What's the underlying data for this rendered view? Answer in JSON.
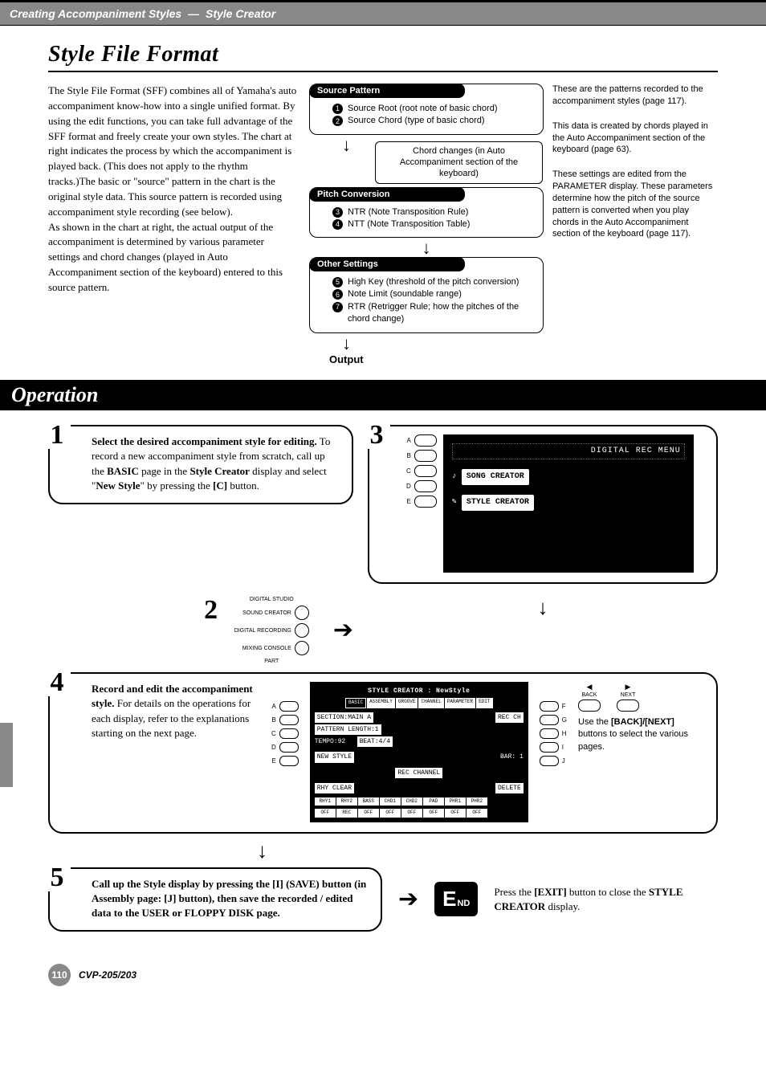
{
  "header": {
    "breadcrumb_left": "Creating Accompaniment Styles",
    "breadcrumb_right": "Style Creator"
  },
  "sff": {
    "title": "Style File Format",
    "para1": "The Style File Format (SFF) combines all of Yamaha's auto accompaniment know-how into a single unified format. By using the edit functions, you can take full advantage of the SFF format and freely create your own styles. The chart at right indicates the process by which the accompaniment is played back. (This does not apply to the rhythm tracks.)The basic or \"source\" pattern in the chart is the original style data. This source pattern is recorded using accompaniment style recording (see below).",
    "para2": "As shown in the chart at right, the actual output of the accompaniment is determined by various parameter settings and chord changes (played in Auto Accompaniment section of the keyboard) entered to this source pattern.",
    "box1_header": "Source Pattern",
    "box1_items": [
      "Source Root (root note of basic chord)",
      "Source Chord (type of basic chord)"
    ],
    "chord_note": "Chord changes (in Auto Accompaniment section of the keyboard)",
    "box2_header": "Pitch Conversion",
    "box2_items": [
      "NTR (Note Transposition Rule)",
      "NTT (Note Transposition Table)"
    ],
    "box3_header": "Other Settings",
    "box3_items": [
      "High Key (threshold of the pitch conversion)",
      "Note Limit (soundable range)",
      "RTR (Retrigger Rule; how the pitches of the chord change)"
    ],
    "output_label": "Output",
    "side1": "These are the patterns recorded to the accompaniment styles (page 117).",
    "side2": "This data is created by chords played in the Auto Accompaniment section of the keyboard (page 63).",
    "side3": "These settings are edited from the PARAMETER display. These parameters determine how the pitch of the source pattern is converted when you play chords in the Auto Accompaniment section of the keyboard (page 117)."
  },
  "operation": {
    "title": "Operation",
    "step1_num": "1",
    "step1_bold": "Select the desired accompaniment style for editing.",
    "step1_rest": " To record a new accompaniment style from scratch, call up the ",
    "step1_basic": "BASIC",
    "step1_mid": " page in the ",
    "step1_sc": "Style Creator",
    "step1_disp": " display and select \"",
    "step1_ns": "New Style",
    "step1_end": "\" by pressing the ",
    "step1_c": "[C]",
    "step1_btn": " button.",
    "step2_num": "2",
    "panel_header": "DIGITAL STUDIO",
    "panel_items": [
      "SOUND CREATOR",
      "DIGITAL RECORDING",
      "MIXING CONSOLE"
    ],
    "panel_footer": "PART",
    "step3_num": "3",
    "screen1_title": "DIGITAL REC MENU",
    "screen1_items": [
      "SONG CREATOR",
      "STYLE CREATOR"
    ],
    "screen1_side_labels": [
      "A",
      "B",
      "C",
      "D",
      "E"
    ],
    "step4_num": "4",
    "step4_bold": "Record and edit the accompaniment style.",
    "step4_rest": " For details on the operations for each display, refer to the explanations starting on the next page.",
    "back_label": "BACK",
    "next_label": "NEXT",
    "back_next_tip_prefix": "Use the ",
    "back_next_tip_bold": "[BACK]/[NEXT]",
    "back_next_tip_suffix": " buttons to select the various pages.",
    "screen2_title": "STYLE CREATOR : NewStyle",
    "screen2_tabs": [
      "BASIC",
      "ASSEMBLY",
      "GROOVE",
      "CHANNEL",
      "PARAMETER",
      "EDIT"
    ],
    "screen2_section": "SECTION:MAIN A",
    "screen2_pattern": "PATTERN LENGTH:1",
    "screen2_tempo": "TEMPO:92",
    "screen2_beat": "BEAT:4/4",
    "screen2_newstyle": "NEW STYLE",
    "screen2_recch": "REC CH",
    "screen2_bar": "BAR:   1",
    "screen2_recchannel": "REC CHANNEL",
    "screen2_rhyclear": "RHY CLEAR",
    "screen2_delete": "DELETE",
    "screen2_tracks": [
      "RHY1",
      "RHY2",
      "BASS",
      "CHD1",
      "CHD2",
      "PAD",
      "PHR1",
      "PHR2"
    ],
    "screen2_states": [
      "OFF",
      "REC",
      "OFF",
      "OFF",
      "OFF",
      "OFF",
      "OFF",
      "OFF"
    ],
    "screen2_side_left": [
      "A",
      "B",
      "C",
      "D",
      "E"
    ],
    "screen2_side_right": [
      "F",
      "G",
      "H",
      "I",
      "J"
    ],
    "step5_num": "5",
    "step5_text": "Call up the Style display by pressing the [I] (SAVE) button (in Assembly page: [J] button), then save the recorded / edited data to the USER or FLOPPY DISK page.",
    "end_big": "E",
    "end_small": "ND",
    "end_tip_prefix": "Press the ",
    "end_tip_bold": "[EXIT]",
    "end_tip_mid": " button to close the ",
    "end_tip_bold2": "STYLE CREATOR",
    "end_tip_suffix": " display."
  },
  "footer": {
    "page_number": "110",
    "model": "CVP-205/203"
  }
}
